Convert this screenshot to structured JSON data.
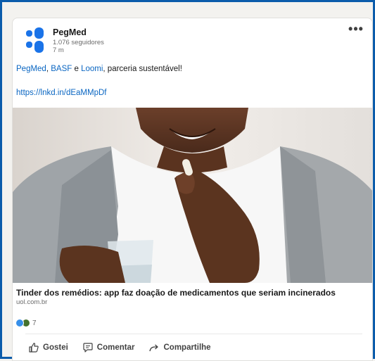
{
  "post": {
    "author": "PegMed",
    "followers": "1.076 seguidores",
    "time_ago": "7 m",
    "more_icon": "•••",
    "text_prefix_mention_1": "PegMed",
    "text_sep_1": ", ",
    "text_prefix_mention_2": "BASF",
    "text_sep_2": " e ",
    "text_prefix_mention_3": "Loomi",
    "text_suffix": ", parceria sustentável!",
    "link": "https://lnkd.in/dEaMMpDf"
  },
  "article": {
    "title": "Tinder dos remédios: app faz doação de medicamentos que seriam incinerados",
    "source": "uol.com.br"
  },
  "social": {
    "reaction_count": "7"
  },
  "actions": {
    "like": "Gostei",
    "comment": "Comentar",
    "share": "Compartilhe"
  },
  "colors": {
    "brand": "#1a73e8",
    "link": "#0a66c2",
    "frame": "#0b5cab"
  }
}
